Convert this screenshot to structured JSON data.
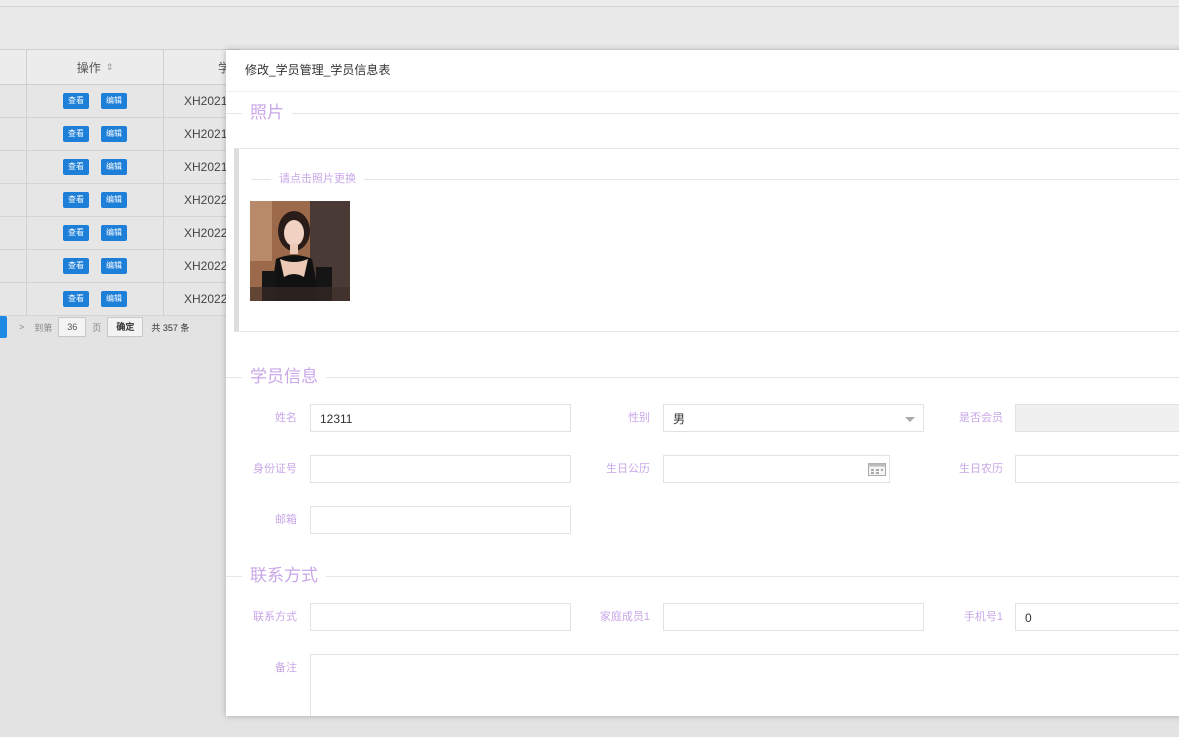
{
  "background": {
    "grid": {
      "header": {
        "actions_label": "操作",
        "sort_icon": "sort-icon",
        "student_no_label": "学"
      },
      "rows": [
        {
          "view": "查看",
          "edit": "编辑",
          "student_no": "XH2021"
        },
        {
          "view": "查看",
          "edit": "编辑",
          "student_no": "XH2021"
        },
        {
          "view": "查看",
          "edit": "编辑",
          "student_no": "XH2021"
        },
        {
          "view": "查看",
          "edit": "编辑",
          "student_no": "XH2022"
        },
        {
          "view": "查看",
          "edit": "编辑",
          "student_no": "XH2022"
        },
        {
          "view": "查看",
          "edit": "编辑",
          "student_no": "XH2022"
        },
        {
          "view": "查看",
          "edit": "编辑",
          "student_no": "XH2022"
        }
      ]
    },
    "pager": {
      "next": ">",
      "goto_label": "到第",
      "page_value": "36",
      "page_unit": "页",
      "confirm": "确定",
      "total": "共 357 条"
    }
  },
  "modal": {
    "title": "修改_学员管理_学员信息表",
    "photo_section": {
      "legend": "照片",
      "hint": "请点击照片更换"
    },
    "info_section": {
      "legend": "学员信息",
      "name_label": "姓名",
      "name_value": "12311",
      "gender_label": "性别",
      "gender_value": "男",
      "member_label": "是否会员",
      "member_value": "",
      "id_label": "身份证号",
      "id_value": "",
      "birthday_solar_label": "生日公历",
      "birthday_solar_value": "",
      "birthday_lunar_label": "生日农历",
      "birthday_lunar_value": "",
      "email_label": "邮箱",
      "email_value": ""
    },
    "contact_section": {
      "legend": "联系方式",
      "contact_label": "联系方式",
      "contact_value": "",
      "family_label": "家庭成员1",
      "family_value": "",
      "phone_label": "手机号1",
      "phone_value": "0",
      "remark_label": "备注",
      "remark_value": ""
    }
  },
  "colors": {
    "label": "#c9a7e8",
    "button": "#1e7fd9",
    "pager_current": "#1e88e5"
  }
}
